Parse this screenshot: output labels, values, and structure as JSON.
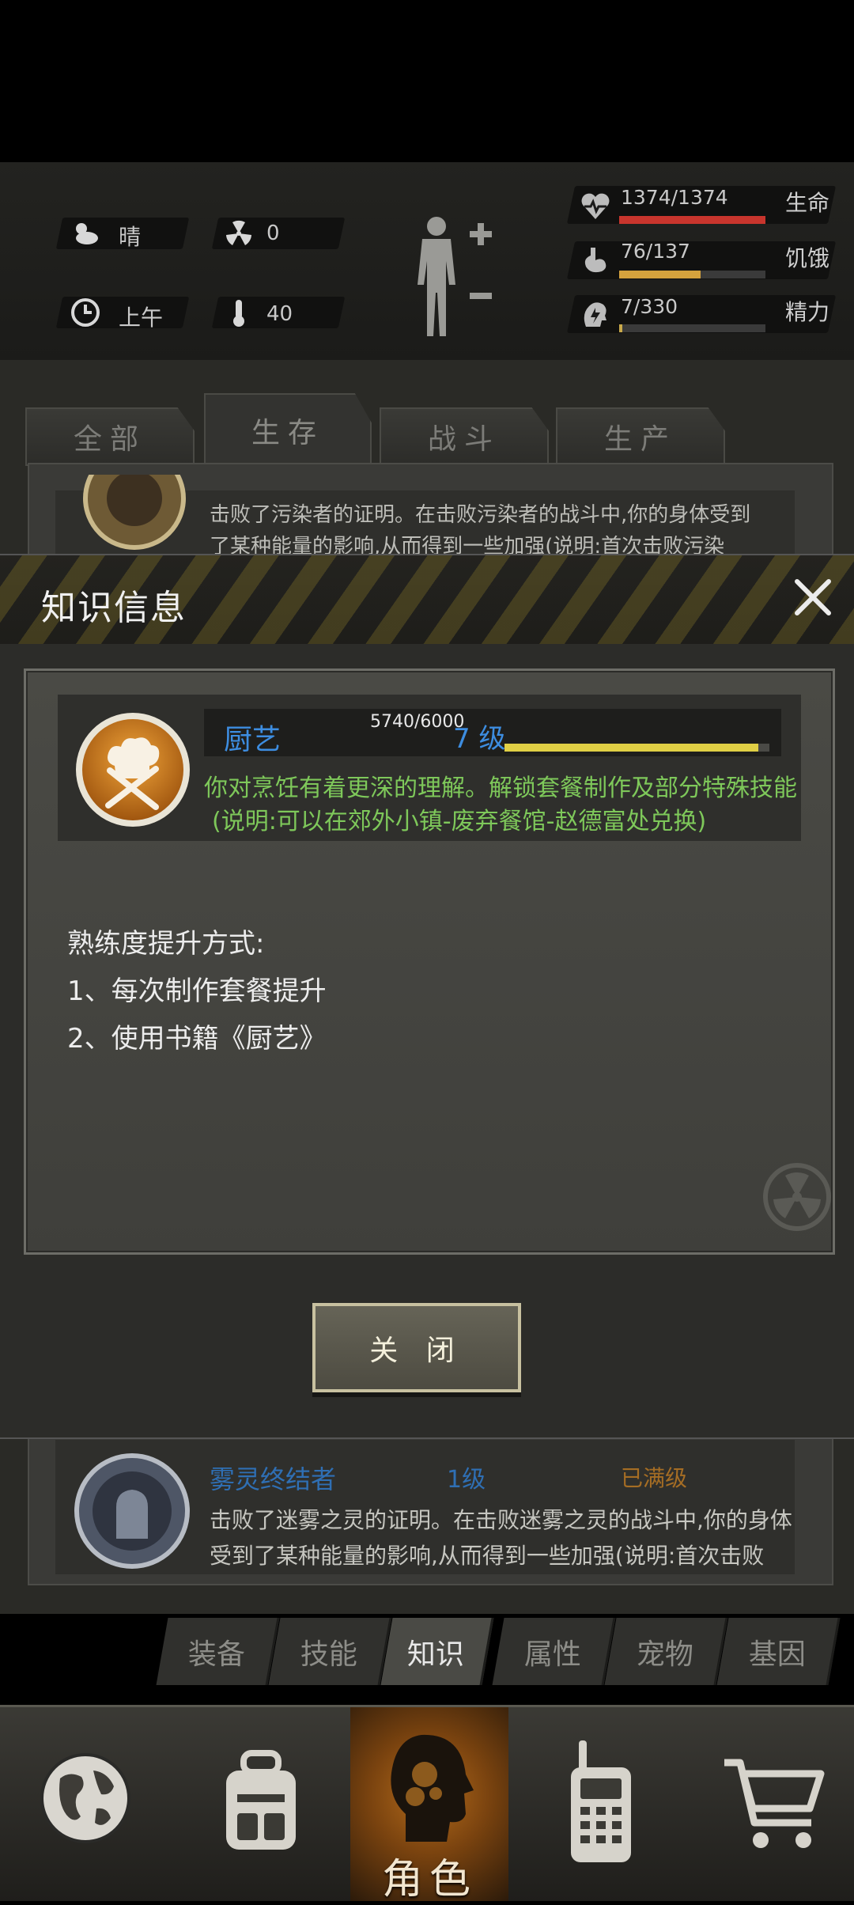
{
  "status": {
    "weather": "晴",
    "radiation": "0",
    "time_of_day": "上午",
    "temperature": "40",
    "stats": [
      {
        "icon": "heart-icon",
        "value_text": "1374/1374",
        "label": "生命",
        "fraction": 1.0,
        "color": "#c8352d"
      },
      {
        "icon": "stomach-icon",
        "value_text": "76/137",
        "label": "饥饿",
        "fraction": 0.555,
        "color": "#d5a23d"
      },
      {
        "icon": "energy-icon",
        "value_text": "7/330",
        "label": "精力",
        "fraction": 0.021,
        "color": "#c9a94a"
      }
    ]
  },
  "tabs": [
    {
      "label": "全部",
      "active": false
    },
    {
      "label": "生存",
      "active": true
    },
    {
      "label": "战斗",
      "active": false
    },
    {
      "label": "生产",
      "active": false
    }
  ],
  "background_item_top": {
    "desc_line1": "击败了污染者的证明。在击败污染者的战斗中,你的身体受到",
    "desc_line2": "了某种能量的影响,从而得到一些加强(说明:首次击败污染"
  },
  "modal": {
    "title": "知识信息",
    "skill": {
      "name": "厨艺",
      "level": "7 级",
      "xp_text": "5740/6000",
      "xp_fraction": 0.957,
      "desc_line1": "你对烹饪有着更深的理解。解锁套餐制作及部分特殊技能",
      "desc_line2": "(说明:可以在郊外小镇-废弃餐馆-赵德富处兑换)"
    },
    "methods_title": "熟练度提升方式:",
    "methods": [
      "1、每次制作套餐提升",
      "2、使用书籍《厨艺》"
    ],
    "close_button": "关 闭"
  },
  "list_item": {
    "name": "雾灵终结者",
    "level": "1级",
    "status": "已满级",
    "desc_line1": "击败了迷雾之灵的证明。在击败迷雾之灵的战斗中,你的身体",
    "desc_line2": "受到了某种能量的影响,从而得到一些加强(说明:首次击败"
  },
  "sub_tabs": [
    {
      "label": "装备",
      "active": false
    },
    {
      "label": "技能",
      "active": false
    },
    {
      "label": "知识",
      "active": true
    },
    {
      "label": "属性",
      "active": false
    },
    {
      "label": "宠物",
      "active": false
    },
    {
      "label": "基因",
      "active": false
    }
  ],
  "bottom_nav": [
    {
      "icon": "globe-icon",
      "label": "",
      "active": false
    },
    {
      "icon": "backpack-icon",
      "label": "",
      "active": false
    },
    {
      "icon": "character-head-icon",
      "label": "角色",
      "active": true
    },
    {
      "icon": "walkie-talkie-icon",
      "label": "",
      "active": false
    },
    {
      "icon": "shopping-cart-icon",
      "label": "",
      "active": false
    }
  ]
}
